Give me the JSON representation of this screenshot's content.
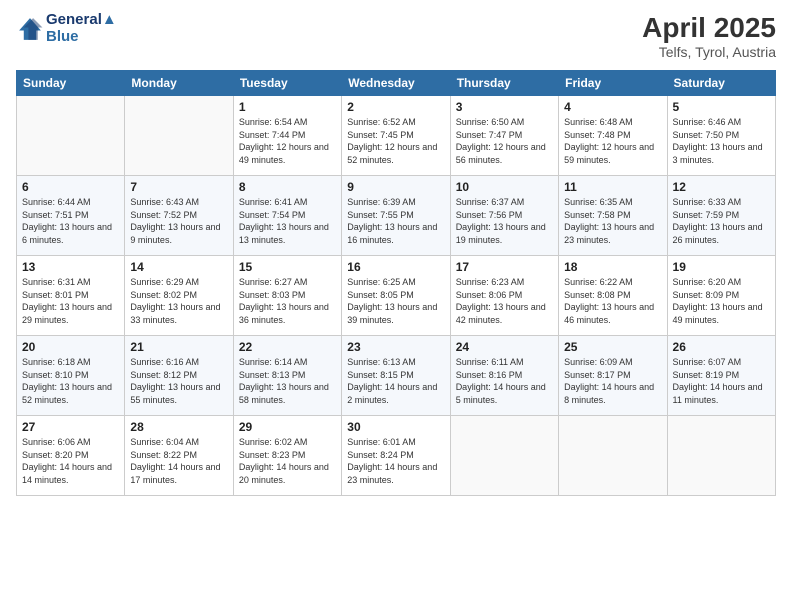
{
  "header": {
    "logo_line1": "General",
    "logo_line2": "Blue",
    "month": "April 2025",
    "location": "Telfs, Tyrol, Austria"
  },
  "weekdays": [
    "Sunday",
    "Monday",
    "Tuesday",
    "Wednesday",
    "Thursday",
    "Friday",
    "Saturday"
  ],
  "weeks": [
    [
      {
        "day": "",
        "info": ""
      },
      {
        "day": "",
        "info": ""
      },
      {
        "day": "1",
        "info": "Sunrise: 6:54 AM\nSunset: 7:44 PM\nDaylight: 12 hours and 49 minutes."
      },
      {
        "day": "2",
        "info": "Sunrise: 6:52 AM\nSunset: 7:45 PM\nDaylight: 12 hours and 52 minutes."
      },
      {
        "day": "3",
        "info": "Sunrise: 6:50 AM\nSunset: 7:47 PM\nDaylight: 12 hours and 56 minutes."
      },
      {
        "day": "4",
        "info": "Sunrise: 6:48 AM\nSunset: 7:48 PM\nDaylight: 12 hours and 59 minutes."
      },
      {
        "day": "5",
        "info": "Sunrise: 6:46 AM\nSunset: 7:50 PM\nDaylight: 13 hours and 3 minutes."
      }
    ],
    [
      {
        "day": "6",
        "info": "Sunrise: 6:44 AM\nSunset: 7:51 PM\nDaylight: 13 hours and 6 minutes."
      },
      {
        "day": "7",
        "info": "Sunrise: 6:43 AM\nSunset: 7:52 PM\nDaylight: 13 hours and 9 minutes."
      },
      {
        "day": "8",
        "info": "Sunrise: 6:41 AM\nSunset: 7:54 PM\nDaylight: 13 hours and 13 minutes."
      },
      {
        "day": "9",
        "info": "Sunrise: 6:39 AM\nSunset: 7:55 PM\nDaylight: 13 hours and 16 minutes."
      },
      {
        "day": "10",
        "info": "Sunrise: 6:37 AM\nSunset: 7:56 PM\nDaylight: 13 hours and 19 minutes."
      },
      {
        "day": "11",
        "info": "Sunrise: 6:35 AM\nSunset: 7:58 PM\nDaylight: 13 hours and 23 minutes."
      },
      {
        "day": "12",
        "info": "Sunrise: 6:33 AM\nSunset: 7:59 PM\nDaylight: 13 hours and 26 minutes."
      }
    ],
    [
      {
        "day": "13",
        "info": "Sunrise: 6:31 AM\nSunset: 8:01 PM\nDaylight: 13 hours and 29 minutes."
      },
      {
        "day": "14",
        "info": "Sunrise: 6:29 AM\nSunset: 8:02 PM\nDaylight: 13 hours and 33 minutes."
      },
      {
        "day": "15",
        "info": "Sunrise: 6:27 AM\nSunset: 8:03 PM\nDaylight: 13 hours and 36 minutes."
      },
      {
        "day": "16",
        "info": "Sunrise: 6:25 AM\nSunset: 8:05 PM\nDaylight: 13 hours and 39 minutes."
      },
      {
        "day": "17",
        "info": "Sunrise: 6:23 AM\nSunset: 8:06 PM\nDaylight: 13 hours and 42 minutes."
      },
      {
        "day": "18",
        "info": "Sunrise: 6:22 AM\nSunset: 8:08 PM\nDaylight: 13 hours and 46 minutes."
      },
      {
        "day": "19",
        "info": "Sunrise: 6:20 AM\nSunset: 8:09 PM\nDaylight: 13 hours and 49 minutes."
      }
    ],
    [
      {
        "day": "20",
        "info": "Sunrise: 6:18 AM\nSunset: 8:10 PM\nDaylight: 13 hours and 52 minutes."
      },
      {
        "day": "21",
        "info": "Sunrise: 6:16 AM\nSunset: 8:12 PM\nDaylight: 13 hours and 55 minutes."
      },
      {
        "day": "22",
        "info": "Sunrise: 6:14 AM\nSunset: 8:13 PM\nDaylight: 13 hours and 58 minutes."
      },
      {
        "day": "23",
        "info": "Sunrise: 6:13 AM\nSunset: 8:15 PM\nDaylight: 14 hours and 2 minutes."
      },
      {
        "day": "24",
        "info": "Sunrise: 6:11 AM\nSunset: 8:16 PM\nDaylight: 14 hours and 5 minutes."
      },
      {
        "day": "25",
        "info": "Sunrise: 6:09 AM\nSunset: 8:17 PM\nDaylight: 14 hours and 8 minutes."
      },
      {
        "day": "26",
        "info": "Sunrise: 6:07 AM\nSunset: 8:19 PM\nDaylight: 14 hours and 11 minutes."
      }
    ],
    [
      {
        "day": "27",
        "info": "Sunrise: 6:06 AM\nSunset: 8:20 PM\nDaylight: 14 hours and 14 minutes."
      },
      {
        "day": "28",
        "info": "Sunrise: 6:04 AM\nSunset: 8:22 PM\nDaylight: 14 hours and 17 minutes."
      },
      {
        "day": "29",
        "info": "Sunrise: 6:02 AM\nSunset: 8:23 PM\nDaylight: 14 hours and 20 minutes."
      },
      {
        "day": "30",
        "info": "Sunrise: 6:01 AM\nSunset: 8:24 PM\nDaylight: 14 hours and 23 minutes."
      },
      {
        "day": "",
        "info": ""
      },
      {
        "day": "",
        "info": ""
      },
      {
        "day": "",
        "info": ""
      }
    ]
  ]
}
